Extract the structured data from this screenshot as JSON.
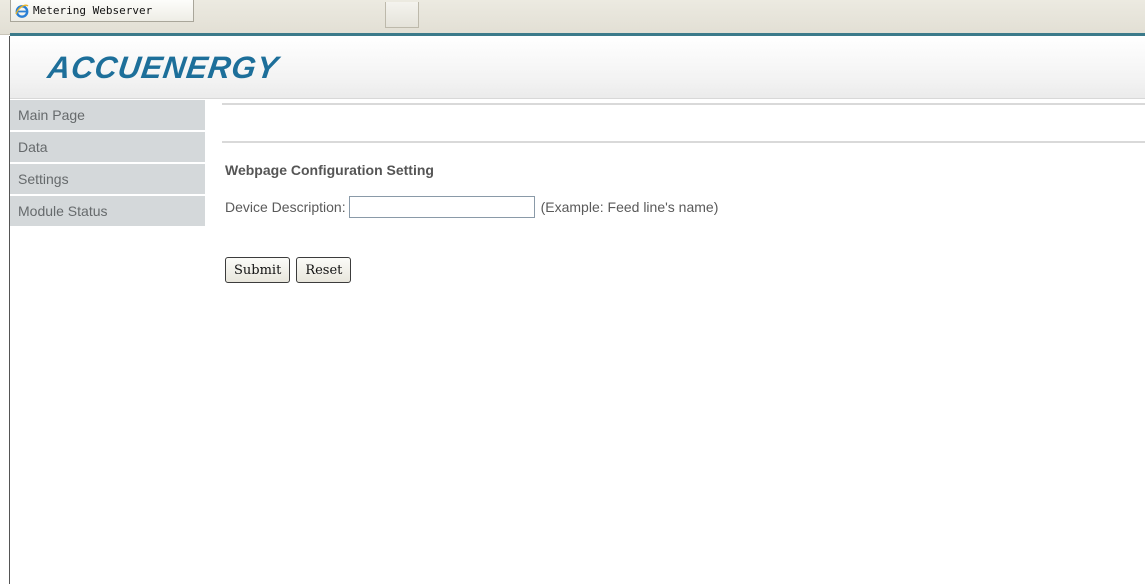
{
  "browser": {
    "tab_title": "Metering Webserver"
  },
  "banner": {
    "logo_text": "ACCUENERGY"
  },
  "sidebar": {
    "items": [
      {
        "label": "Main Page"
      },
      {
        "label": "Data"
      },
      {
        "label": "Settings"
      },
      {
        "label": "Module Status"
      }
    ]
  },
  "main": {
    "section_title": "Webpage Configuration Setting",
    "device_description": {
      "label": "Device Description:",
      "value": "",
      "hint": "(Example: Feed line's name)"
    },
    "submit_label": "Submit",
    "reset_label": "Reset"
  },
  "colors": {
    "logo": "#1d6f9a",
    "nav_bg": "#d4d8da",
    "tab_accent": "#3b7a8a"
  }
}
